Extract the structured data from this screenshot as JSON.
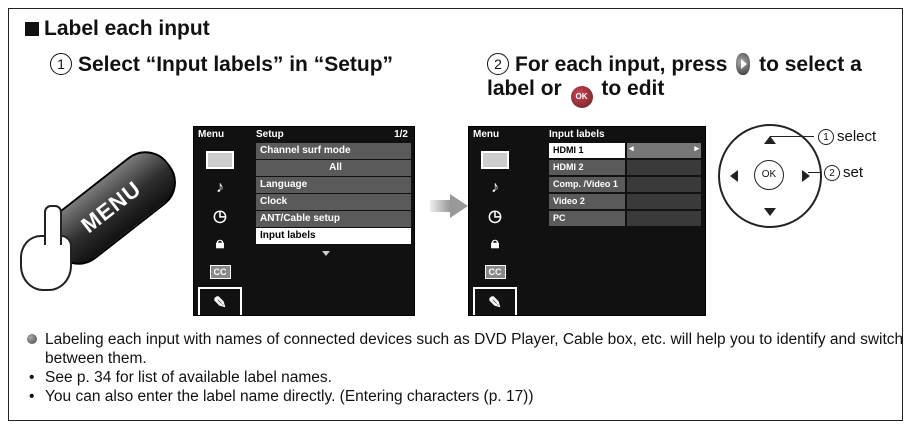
{
  "section": {
    "title": "Label each input"
  },
  "step1": {
    "number": "1",
    "text": "Select “Input labels” in “Setup”"
  },
  "step2": {
    "number": "2",
    "text_a": "For each input, press",
    "text_b": "to select a label or",
    "text_c": "to edit",
    "ok_glyph": "OK"
  },
  "menu_button": {
    "label": "MENU"
  },
  "screen1": {
    "menu_label": "Menu",
    "title": "Setup",
    "page": "1/2",
    "items": [
      "Channel surf mode",
      "All",
      "Language",
      "Clock",
      "ANT/Cable setup",
      "Input labels"
    ],
    "selected_index": 5,
    "icons": [
      "tv-icon",
      "music-note-icon",
      "clock-icon",
      "lock-icon",
      "cc-icon",
      "wrench-icon"
    ],
    "cc_text": "CC"
  },
  "screen2": {
    "menu_label": "Menu",
    "title": "Input labels",
    "items": [
      "HDMI 1",
      "HDMI 2",
      "Comp. /Video 1",
      "Video 2",
      "PC"
    ],
    "selected_index": 0,
    "cc_text": "CC"
  },
  "remote": {
    "ok_label": "OK",
    "select": {
      "number": "1",
      "label": "select"
    },
    "set": {
      "number": "2",
      "label": "set"
    }
  },
  "notes": [
    "Labeling each input with names of connected devices such as DVD Player, Cable box, etc. will help you to identify and switch between them.",
    "See p. 34 for list of available label names.",
    "You can also enter the label name directly. (Entering characters (p. 17))"
  ]
}
